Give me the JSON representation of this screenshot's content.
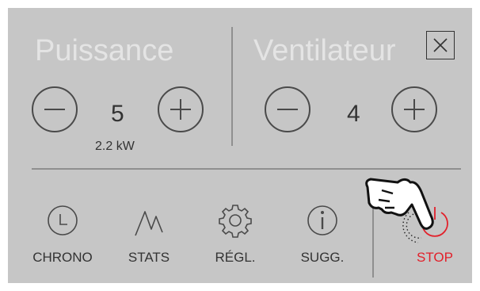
{
  "puissance": {
    "title": "Puissance",
    "value": "5",
    "subvalue": "2.2 kW"
  },
  "ventilateur": {
    "title": "Ventilateur",
    "value": "4"
  },
  "toolbar": {
    "chrono": "CHRONO",
    "stats": "STATS",
    "settings": "RÉGL.",
    "suggestions": "SUGG.",
    "stop": "STOP"
  },
  "colors": {
    "panel": "#c6c6c6",
    "title": "#e4e4e4",
    "stop": "#e2202a",
    "text": "#333333"
  },
  "icons": [
    "minus-icon",
    "plus-icon",
    "close-icon",
    "clock-icon",
    "stats-icon",
    "gear-icon",
    "info-icon",
    "power-icon",
    "hand-pointer-icon"
  ]
}
